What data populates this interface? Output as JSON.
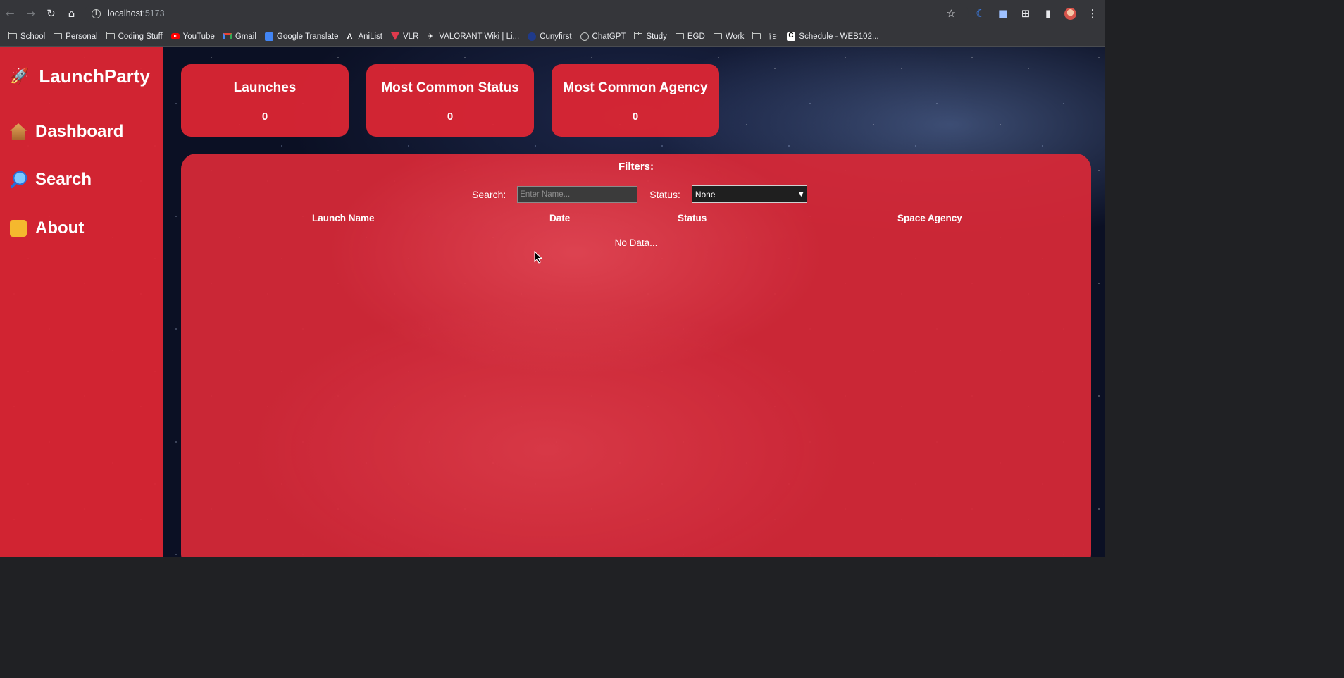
{
  "browser": {
    "url_host": "localhost",
    "url_port": ":5173",
    "bookmarks": [
      {
        "label": "School",
        "icon": "folder-icon"
      },
      {
        "label": "Personal",
        "icon": "folder-icon"
      },
      {
        "label": "Coding Stuff",
        "icon": "folder-icon"
      },
      {
        "label": "YouTube",
        "icon": "youtube-icon"
      },
      {
        "label": "Gmail",
        "icon": "gmail-icon"
      },
      {
        "label": "Google Translate",
        "icon": "google-translate-icon"
      },
      {
        "label": "AniList",
        "icon": "anilist-icon"
      },
      {
        "label": "VLR",
        "icon": "vlr-icon"
      },
      {
        "label": "VALORANT Wiki | Li...",
        "icon": "valorant-icon"
      },
      {
        "label": "Cunyfirst",
        "icon": "cunyfirst-icon"
      },
      {
        "label": "ChatGPT",
        "icon": "chatgpt-icon"
      },
      {
        "label": "Study",
        "icon": "folder-icon"
      },
      {
        "label": "EGD",
        "icon": "folder-icon"
      },
      {
        "label": "Work",
        "icon": "folder-icon"
      },
      {
        "label": "ゴミ",
        "icon": "folder-icon"
      },
      {
        "label": "Schedule - WEB102...",
        "icon": "canvas-icon"
      }
    ]
  },
  "sidebar": {
    "brand": "LaunchParty",
    "brand_icon": "rocket-icon",
    "items": [
      {
        "label": "Dashboard",
        "icon": "house-icon"
      },
      {
        "label": "Search",
        "icon": "magnifying-glass-icon"
      },
      {
        "label": "About",
        "icon": "rock-hand-icon"
      }
    ]
  },
  "cards": [
    {
      "title": "Launches",
      "value": "0"
    },
    {
      "title": "Most Common Status",
      "value": "0"
    },
    {
      "title": "Most Common Agency",
      "value": "0"
    }
  ],
  "filters": {
    "title": "Filters:",
    "search_label": "Search:",
    "search_placeholder": "Enter Name...",
    "status_label": "Status:",
    "status_selected": "None"
  },
  "table": {
    "columns": [
      "Launch Name",
      "Date",
      "Status",
      "Space Agency"
    ],
    "empty_text": "No Data..."
  },
  "colors": {
    "accent": "#dc2634",
    "background": "#0b1024"
  }
}
